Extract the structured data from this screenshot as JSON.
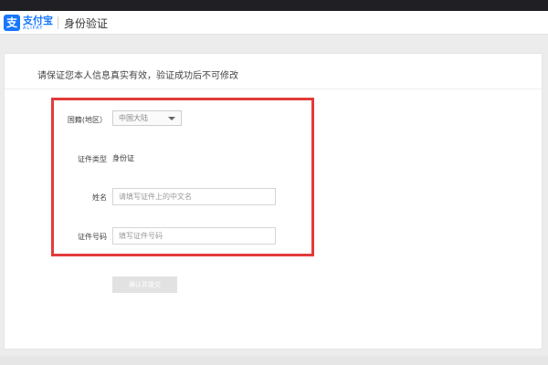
{
  "header": {
    "logo_cn": "支付宝",
    "logo_en": "ALIPAY",
    "title": "身份验证"
  },
  "notice": "请保证您本人信息真实有效，验证成功后不可修改",
  "form": {
    "country": {
      "label": "国籍(地区）",
      "selected": "中国大陆"
    },
    "id_type": {
      "label": "证件类型",
      "value": "身份证"
    },
    "name": {
      "label": "姓名",
      "placeholder": "请填写证件上的中文名",
      "value": ""
    },
    "id_number": {
      "label": "证件号码",
      "placeholder": "填写证件号码",
      "value": ""
    },
    "submit_label": "确认并提交"
  },
  "colors": {
    "accent": "#1677ff",
    "highlight": "#e23b3b",
    "disabled_button": "#e2e2e2"
  }
}
